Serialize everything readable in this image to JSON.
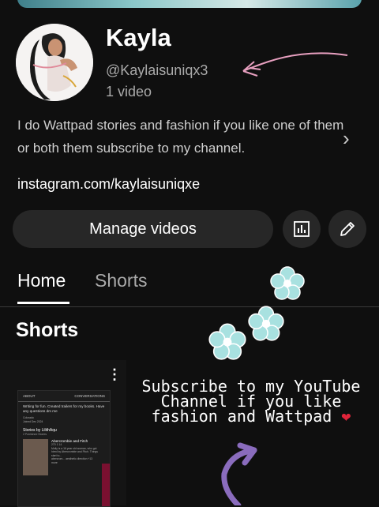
{
  "channel": {
    "name": "Kayla",
    "handle": "@Kaylaisuniqx3",
    "video_count": "1 video",
    "bio": "I do Wattpad stories and fashion if you like one of them or both them subscribe to my channel.",
    "link": "instagram.com/kaylaisuniqxe"
  },
  "actions": {
    "manage_label": "Manage videos",
    "analytics_icon": "bar-chart-icon",
    "edit_icon": "pencil-icon"
  },
  "tabs": [
    {
      "label": "Home",
      "active": true
    },
    {
      "label": "Shorts",
      "active": false
    }
  ],
  "section_title": "Shorts",
  "short_preview": {
    "tab_about": "ABOUT",
    "tab_conversations": "CONVERSATIONS",
    "bio_text": "Writing for fun. Created trailers for my books. Have any questions dm me",
    "meta_1": "Colorado",
    "meta_2": "Joined Dec 2024",
    "stories_heading": "Stories by LilithAqu",
    "stories_sub": "2 Published Stories",
    "story_title": "Abercrombie and Fitch",
    "story_stats": "270  1  14",
    "story_desc": "Molly is a 16 year old woman, who got hired by Abercrombie and Fitch. Things start to...",
    "tag_1": "abercrom...",
    "tag_2": "aesthetic",
    "tag_3": "direction",
    "tag_more": "+13 more"
  },
  "overlay_text": {
    "line1": "Subscribe to my YouTube",
    "line2": "Channel if you like",
    "line3": "fashion and Wattpad"
  },
  "colors": {
    "background": "#0f0f0f",
    "button_bg": "#272727",
    "flower": "#a8e1e0",
    "arrow_pink": "#e8a0c0",
    "arrow_purple": "#8a6cbd",
    "heart": "#e0243a"
  }
}
